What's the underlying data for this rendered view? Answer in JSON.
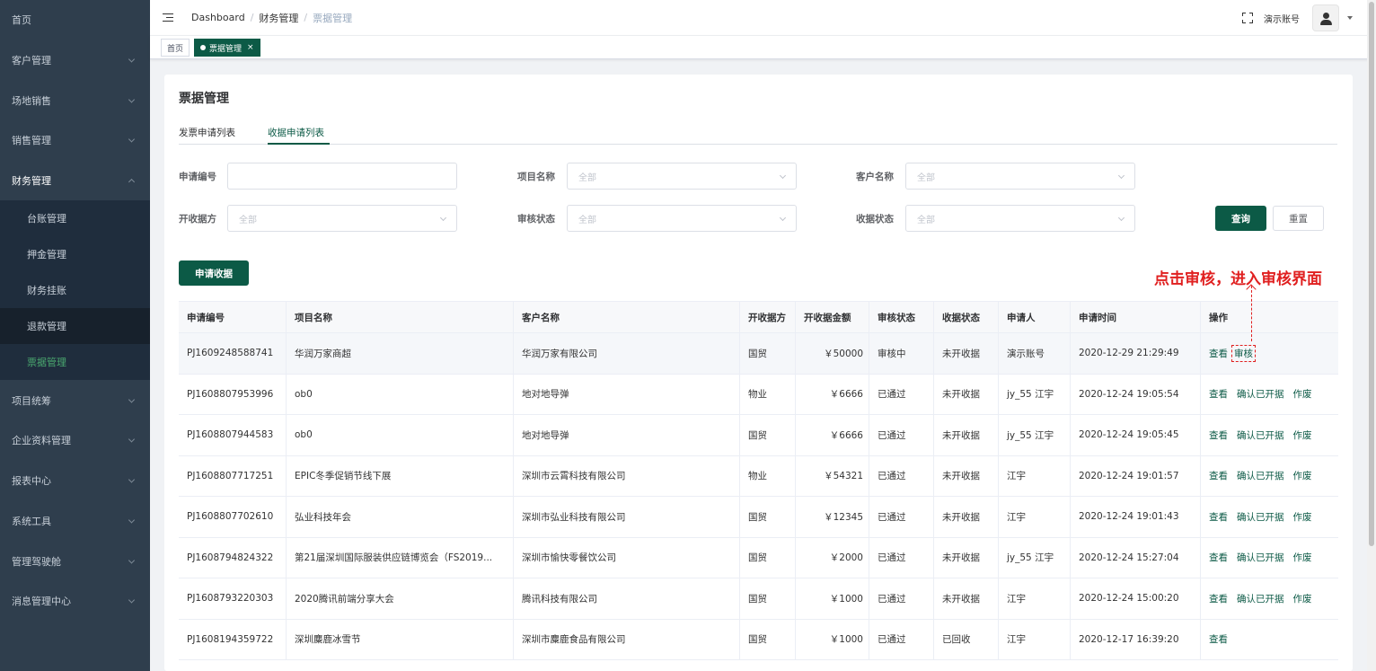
{
  "sidebar": {
    "items": [
      {
        "label": "首页"
      },
      {
        "label": "客户管理"
      },
      {
        "label": "场地销售"
      },
      {
        "label": "销售管理"
      },
      {
        "label": "财务管理"
      },
      {
        "label": "项目统筹"
      },
      {
        "label": "企业资料管理"
      },
      {
        "label": "报表中心"
      },
      {
        "label": "系统工具"
      },
      {
        "label": "管理驾驶舱"
      },
      {
        "label": "消息管理中心"
      }
    ],
    "finance_sub": [
      {
        "label": "台账管理"
      },
      {
        "label": "押金管理"
      },
      {
        "label": "财务挂账"
      },
      {
        "label": "退款管理"
      },
      {
        "label": "票据管理"
      }
    ]
  },
  "header": {
    "breadcrumb": [
      "Dashboard",
      "财务管理",
      "票据管理"
    ],
    "separator": "/",
    "account_name": "演示账号"
  },
  "tags": {
    "home": "首页",
    "current": "票据管理",
    "close": "×"
  },
  "page": {
    "title": "票据管理",
    "tabs": [
      "发票申请列表",
      "收据申请列表"
    ]
  },
  "filters": {
    "apply_no": {
      "label": "申请编号",
      "value": ""
    },
    "project_name": {
      "label": "项目名称",
      "value": "全部"
    },
    "customer_name": {
      "label": "客户名称",
      "value": "全部"
    },
    "issuer": {
      "label": "开收据方",
      "value": "全部"
    },
    "audit_status": {
      "label": "审核状态",
      "value": "全部"
    },
    "receipt_status": {
      "label": "收据状态",
      "value": "全部"
    },
    "query_label": "查询",
    "reset_label": "重置"
  },
  "apply_button": "申请收据",
  "annotation": "点击审核，进入审核界面",
  "table": {
    "columns": [
      "申请编号",
      "项目名称",
      "客户名称",
      "开收据方",
      "开收据金额",
      "审核状态",
      "收据状态",
      "申请人",
      "申请时间",
      "操作"
    ],
    "rows": [
      {
        "no": "PJ1609248588741",
        "project": "华润万家商超",
        "customer": "华润万家有限公司",
        "issuer": "国贸",
        "amount": "￥50000",
        "audit": "审核中",
        "receipt": "未开收据",
        "applicant": "演示账号",
        "time": "2020-12-29 21:29:49",
        "actions": [
          "查看",
          "审核"
        ]
      },
      {
        "no": "PJ1608807953996",
        "project": "ob0",
        "customer": "地对地导弹",
        "issuer": "物业",
        "amount": "￥6666",
        "audit": "已通过",
        "receipt": "未开收据",
        "applicant": "jy_55 江宇",
        "time": "2020-12-24 19:05:54",
        "actions": [
          "查看",
          "确认已开据",
          "作废"
        ]
      },
      {
        "no": "PJ1608807944583",
        "project": "ob0",
        "customer": "地对地导弹",
        "issuer": "国贸",
        "amount": "￥6666",
        "audit": "已通过",
        "receipt": "未开收据",
        "applicant": "jy_55 江宇",
        "time": "2020-12-24 19:05:45",
        "actions": [
          "查看",
          "确认已开据",
          "作废"
        ]
      },
      {
        "no": "PJ1608807717251",
        "project": "EPIC冬季促销节线下展",
        "customer": "深圳市云霄科技有限公司",
        "issuer": "物业",
        "amount": "￥54321",
        "audit": "已通过",
        "receipt": "未开收据",
        "applicant": "江宇",
        "time": "2020-12-24 19:01:57",
        "actions": [
          "查看",
          "确认已开据",
          "作废"
        ]
      },
      {
        "no": "PJ1608807702610",
        "project": "弘业科技年会",
        "customer": "深圳市弘业科技有限公司",
        "issuer": "国贸",
        "amount": "￥12345",
        "audit": "已通过",
        "receipt": "未开收据",
        "applicant": "江宇",
        "time": "2020-12-24 19:01:43",
        "actions": [
          "查看",
          "确认已开据",
          "作废"
        ]
      },
      {
        "no": "PJ1608794824322",
        "project": "第21届深圳国际服装供应链博览会（FS2019...",
        "customer": "深圳市愉快零餐饮公司",
        "issuer": "国贸",
        "amount": "￥2000",
        "audit": "已通过",
        "receipt": "未开收据",
        "applicant": "jy_55 江宇",
        "time": "2020-12-24 15:27:04",
        "actions": [
          "查看",
          "确认已开据",
          "作废"
        ]
      },
      {
        "no": "PJ1608793220303",
        "project": "2020腾讯前端分享大会",
        "customer": "腾讯科技有限公司",
        "issuer": "国贸",
        "amount": "￥1000",
        "audit": "已通过",
        "receipt": "未开收据",
        "applicant": "江宇",
        "time": "2020-12-24 15:00:20",
        "actions": [
          "查看",
          "确认已开据",
          "作废"
        ]
      },
      {
        "no": "PJ1608194359722",
        "project": "深圳麋鹿冰雪节",
        "customer": "深圳市麋鹿食品有限公司",
        "issuer": "国贸",
        "amount": "￥1000",
        "audit": "已通过",
        "receipt": "已回收",
        "applicant": "江宇",
        "time": "2020-12-17 16:39:20",
        "actions": [
          "查看"
        ]
      }
    ]
  },
  "colors": {
    "brand": "#0c5a46",
    "sidebar_bg": "#2f3e4d",
    "annotation": "#e02020"
  }
}
